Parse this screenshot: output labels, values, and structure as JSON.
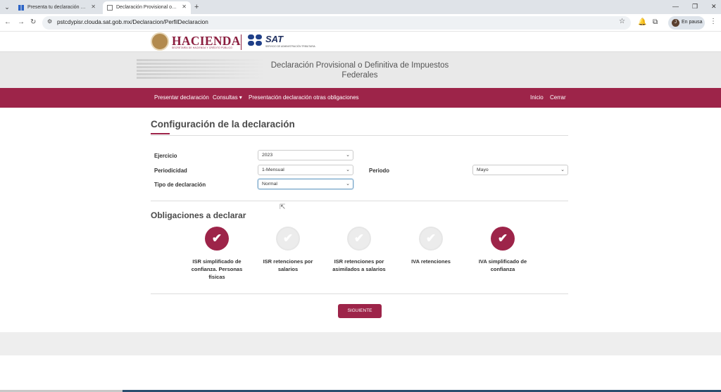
{
  "browser": {
    "tabs": [
      {
        "title": "Presenta tu declaración de pago"
      },
      {
        "title": "Declaración Provisional o Defini"
      }
    ],
    "new_tab": "+",
    "url": "pstcdypisr.clouda.sat.gob.mx/Declaracion/PerfilDeclaracion",
    "profile_initial": "J",
    "profile_label": "En pausa"
  },
  "header": {
    "hacienda": "HACIENDA",
    "hacienda_sub": "SECRETARÍA DE HACIENDA Y CRÉDITO PÚBLICO",
    "sat": "SAT",
    "sat_sub": "SERVICIO DE ADMINISTRACIÓN TRIBUTARIA"
  },
  "banner": {
    "title": "Declaración Provisional o Definitiva de Impuestos Federales"
  },
  "nav": {
    "presentar": "Presentar declaración",
    "consultas": "Consultas ▾",
    "otras": "Presentación declaración otras obligaciones",
    "inicio": "Inicio",
    "cerrar": "Cerrar"
  },
  "config": {
    "title": "Configuración de la declaración",
    "ejercicio_label": "Ejercicio",
    "ejercicio_value": "2023",
    "periodicidad_label": "Periodicidad",
    "periodicidad_value": "1-Mensual",
    "periodo_label": "Periodo",
    "periodo_value": "Mayo",
    "tipo_label": "Tipo de declaración",
    "tipo_value": "Normal"
  },
  "obligaciones": {
    "title": "Obligaciones a declarar",
    "items": [
      {
        "label": "ISR simplificado de confianza. Personas físicas",
        "selected": true
      },
      {
        "label": "ISR retenciones por salarios",
        "selected": false
      },
      {
        "label": "ISR retenciones por asimilados a salarios",
        "selected": false
      },
      {
        "label": "IVA retenciones",
        "selected": false
      },
      {
        "label": "IVA simplificado de confianza",
        "selected": true
      }
    ]
  },
  "actions": {
    "siguiente": "SIGUIENTE"
  },
  "colors": {
    "brand": "#9d2449",
    "sat_blue": "#1f3f88"
  }
}
